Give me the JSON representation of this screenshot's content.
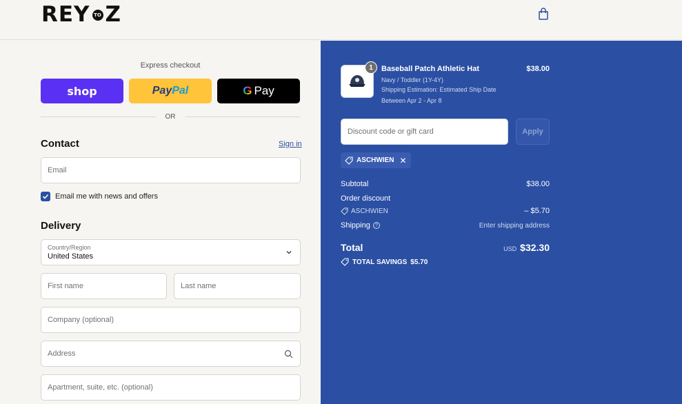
{
  "header": {
    "logo_left": "REY",
    "logo_mid": "TO",
    "logo_right": "Z"
  },
  "express": {
    "label": "Express checkout",
    "shop_label": "shop",
    "paypal_p1": "Pay",
    "paypal_p2": "Pal",
    "gpay_g": "G",
    "gpay_label": "Pay",
    "or_label": "OR"
  },
  "contact": {
    "title": "Contact",
    "signin_label": "Sign in",
    "email_placeholder": "Email",
    "newsletter_label": "Email me with news and offers",
    "newsletter_checked": true
  },
  "delivery": {
    "title": "Delivery",
    "country_label": "Country/Region",
    "country_value": "United States",
    "first_name": "First name",
    "last_name": "Last name",
    "company": "Company (optional)",
    "address": "Address",
    "apartment": "Apartment, suite, etc. (optional)"
  },
  "order": {
    "item": {
      "quantity": "1",
      "name": "Baseball Patch Athletic Hat",
      "price": "$38.00",
      "variant": "Navy / Toddler (1Y-4Y)",
      "shipping_line1": "Shipping Estimation: Estimated Ship Date",
      "shipping_line2": "Between Apr 2 - Apr 8"
    },
    "discount_placeholder": "Discount code or gift card",
    "apply_label": "Apply",
    "code_chip": "ASCHWIEN",
    "subtotal_label": "Subtotal",
    "subtotal_value": "$38.00",
    "order_discount_label": "Order discount",
    "discount_code": "ASCHWIEN",
    "discount_value": "– $5.70",
    "shipping_label": "Shipping",
    "shipping_value": "Enter shipping address",
    "total_label": "Total",
    "total_currency": "USD",
    "total_value": "$32.30",
    "savings_label": "TOTAL SAVINGS",
    "savings_value": "$5.70"
  },
  "colors": {
    "accent": "#2b4fa3",
    "shop_purple": "#5a31f4",
    "paypal_yellow": "#ffc439"
  }
}
